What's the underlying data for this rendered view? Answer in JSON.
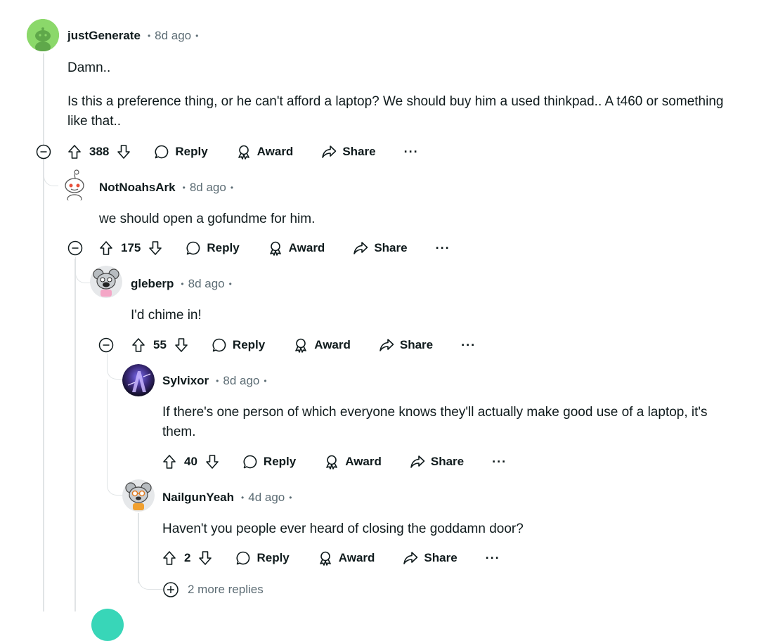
{
  "comments": [
    {
      "author": "justGenerate",
      "time": "8d ago",
      "body": [
        "Damn..",
        "Is this a preference thing, or he can't afford a laptop? We should buy him a used thinkpad.. A t460 or something like that.."
      ],
      "score": "388"
    },
    {
      "author": "NotNoahsArk",
      "time": "8d ago",
      "body": [
        "we should open a gofundme for him."
      ],
      "score": "175"
    },
    {
      "author": "gleberp",
      "time": "8d ago",
      "body": [
        "I'd chime in!"
      ],
      "score": "55"
    },
    {
      "author": "Sylvixor",
      "time": "8d ago",
      "body": [
        "If there's one person of which everyone knows they'll actually make good use of a laptop, it's them."
      ],
      "score": "40"
    },
    {
      "author": "NailgunYeah",
      "time": "4d ago",
      "body": [
        "Haven't you people ever heard of closing the goddamn door?"
      ],
      "score": "2"
    }
  ],
  "actions": {
    "reply": "Reply",
    "award": "Award",
    "share": "Share",
    "more": "···"
  },
  "more_replies": "2 more replies",
  "colors": {
    "accent_green": "#7fd15a",
    "muted": "#5c6c74",
    "thread_line": "#e1e4e6"
  }
}
